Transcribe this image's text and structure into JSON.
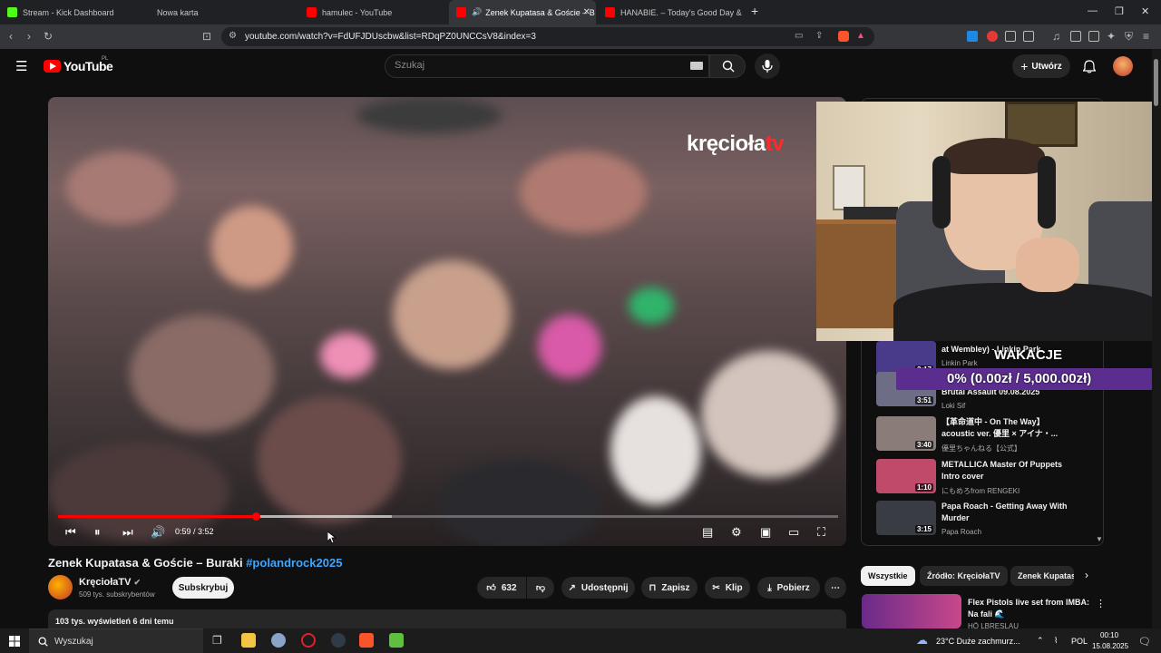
{
  "browser": {
    "tabs": [
      {
        "title": "Stream - Kick Dashboard",
        "color": "#53fc18"
      },
      {
        "title": "Nowa karta",
        "color": "#888888"
      },
      {
        "title": "hamulec - YouTube",
        "color": "#ff0000"
      },
      {
        "title": "Zenek Kupatasa & Goście – B",
        "color": "#ff0000"
      },
      {
        "title": "HANABIE. – Today's Good Day & So",
        "color": "#ff0000"
      }
    ],
    "new_tab": "+",
    "url": "youtube.com/watch?v=FdUFJDUscbw&list=RDqPZ0UNCCsV8&index=3"
  },
  "youtube": {
    "logo_text": "YouTube",
    "country_code": "PL",
    "search_placeholder": "Szukaj",
    "create_label": "Utwórz",
    "video": {
      "watermark_main": "kręcioła",
      "watermark_suffix": "tv",
      "current_time": "0:59",
      "duration": "3:52",
      "time_display": "0:59 / 3:52",
      "progress": 0.254,
      "title_main": "Zenek Kupatasa & Goście – Buraki ",
      "title_hashtag": "#polandrock2025"
    },
    "channel": {
      "name": "KręciołaTV",
      "subscribers": "509 tys. subskrybentów",
      "subscribe_label": "Subskrybuj"
    },
    "actions": {
      "likes": "632",
      "share": "Udostępnij",
      "save": "Zapisz",
      "clip": "Klip",
      "download": "Pobierz"
    },
    "description": {
      "views_date": "103 tys. wyświetleń  6 dni temu"
    },
    "playlist": [
      {
        "title": "at Wembley) - Linkin Park",
        "channel": "Linkin Park",
        "duration": "3:17",
        "color": "#4a3a8a"
      },
      {
        "title": "Brutal Assault 09.08.2025",
        "channel": "Loki Sif",
        "duration": "3:51",
        "color": "#6d6e86"
      },
      {
        "title": "【革命道中 - On The Way】acoustic ver. 優里 × アイナ・...",
        "channel": "優里ちゃんねる【公式】",
        "duration": "3:40",
        "color": "#8a7c78"
      },
      {
        "title": "METALLICA Master Of Puppets Intro cover",
        "channel": "にもめろfrom RENGEKI",
        "duration": "1:10",
        "color": "#c04a6a"
      },
      {
        "title": "Papa Roach - Getting Away With Murder",
        "channel": "Papa Roach",
        "duration": "3:15",
        "color": "#3a3c44"
      }
    ],
    "chips": [
      "Wszystkie",
      "Źródło: KręciołaTV",
      "Zenek Kupatas"
    ],
    "recommended": {
      "title": "Flex Pistols live set from IMBA: Na fali 🌊",
      "channel": "HÖ LBRESLAU"
    }
  },
  "stream_overlay": {
    "goal_title": "WAKACJE",
    "goal_text": "0% (0.00zł / 5,000.00zł)",
    "goal_color": "#5b2d8f"
  },
  "taskbar": {
    "search_placeholder": "Wyszukaj",
    "weather": "23°C  Duże zachmurz...",
    "language": "POL",
    "time": "00:10",
    "date": "15.08.2025"
  }
}
